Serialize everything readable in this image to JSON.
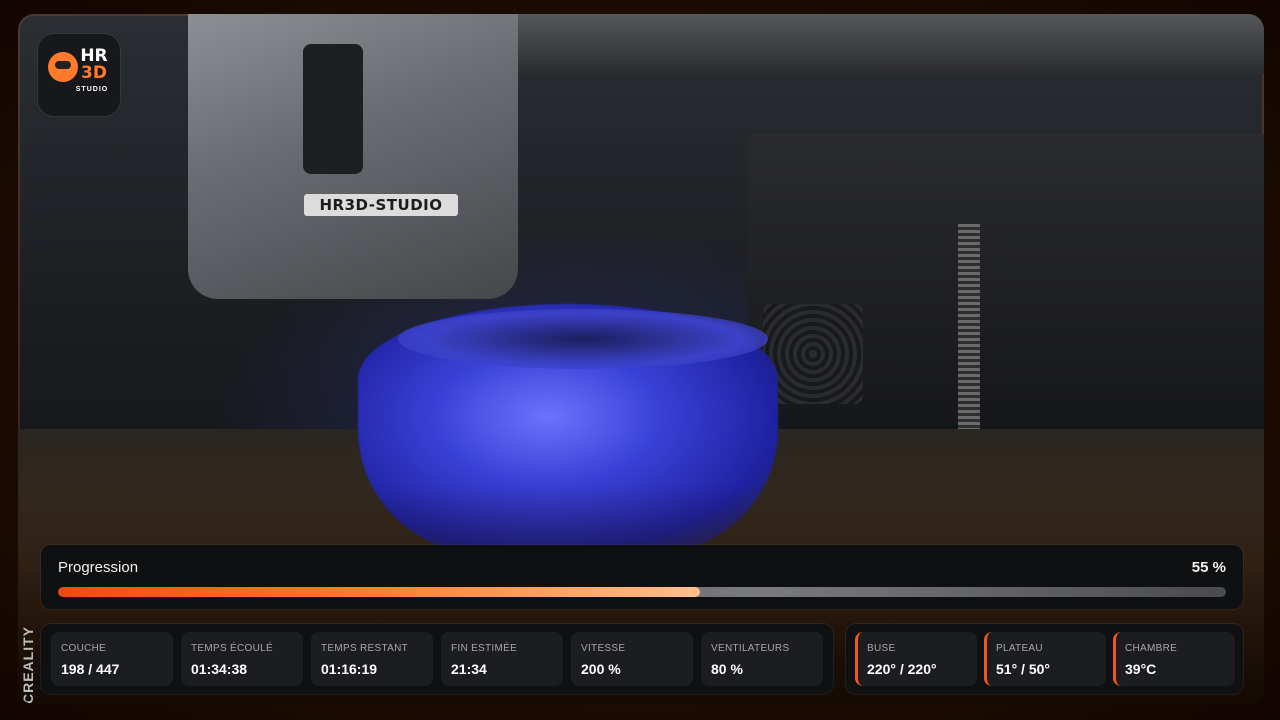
{
  "camera": {
    "nameplate": "HR3D-STUDIO",
    "side_text": "CREALITY"
  },
  "logo": {
    "line1": "HR",
    "line2": "3D",
    "sub": "STUDIO"
  },
  "progress": {
    "label": "Progression",
    "value_text": "55 %",
    "fraction": 0.55
  },
  "stats": [
    {
      "label": "COUCHE",
      "value": "198 / 447"
    },
    {
      "label": "TEMPS ÉCOULÉ",
      "value": "01:34:38"
    },
    {
      "label": "TEMPS RESTANT",
      "value": "01:16:19"
    },
    {
      "label": "FIN ESTIMÉE",
      "value": "21:34"
    },
    {
      "label": "VITESSE",
      "value": "200 %"
    },
    {
      "label": "VENTILATEURS",
      "value": "80 %"
    }
  ],
  "temperatures": [
    {
      "label": "BUSE",
      "value": "220° / 220°"
    },
    {
      "label": "PLATEAU",
      "value": "51° / 50°"
    },
    {
      "label": "CHAMBRE",
      "value": "39°C"
    }
  ],
  "colors": {
    "accent": "#f05a14",
    "panel": "#0f1012",
    "card": "#1c1d21"
  }
}
